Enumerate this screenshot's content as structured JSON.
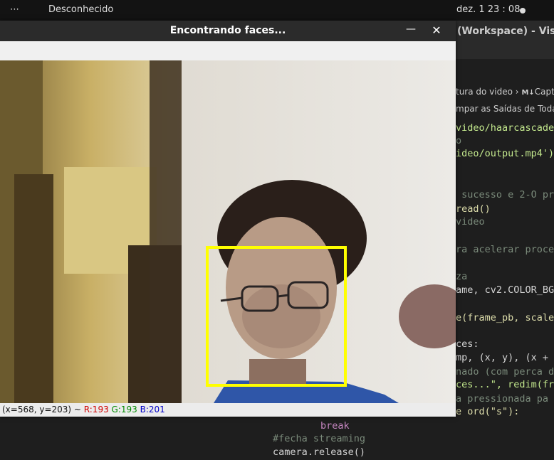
{
  "topbar": {
    "menu_dots": "⋯",
    "app_name": "Desconhecido",
    "clock": "dez. 1  23 : 08"
  },
  "vscode": {
    "title": "(Workspace) - Visua",
    "breadcrumb_left": "tura do video",
    "breadcrumb_sep": "›",
    "breadcrumb_md": "M↓",
    "breadcrumb_right": "Capt",
    "outputs_label": "mpar as Saídas de Todas",
    "lines": [
      "video/haarcascade",
      "o",
      "ideo/output.mp4')",
      "",
      "",
      " sucesso e 2-O pr",
      "read()",
      "video",
      "",
      "ra acelerar proce",
      "",
      "za",
      "ame, cv2.COLOR_BG",
      "",
      "e(frame_pb, scale",
      "",
      "ces:",
      "mp, (x, y), (x +",
      "nado (com perca d",
      "ces...\", redim(fr",
      "a pressionada pa",
      "e ord(\"s\"):"
    ],
    "bottom_lines": [
      "break",
      "#fecha streaming",
      "camera.release()"
    ]
  },
  "cv_window": {
    "title": "Encontrando faces...",
    "minimize": "—",
    "close": "✕",
    "status": {
      "coords": "(x=568, y=203) ~ ",
      "r": "R:193",
      "g": "G:193",
      "b": "B:201"
    }
  },
  "colors": {
    "detect_box": "#ffff00",
    "topbar_bg": "#131313",
    "editor_bg": "#1e1e1e"
  }
}
